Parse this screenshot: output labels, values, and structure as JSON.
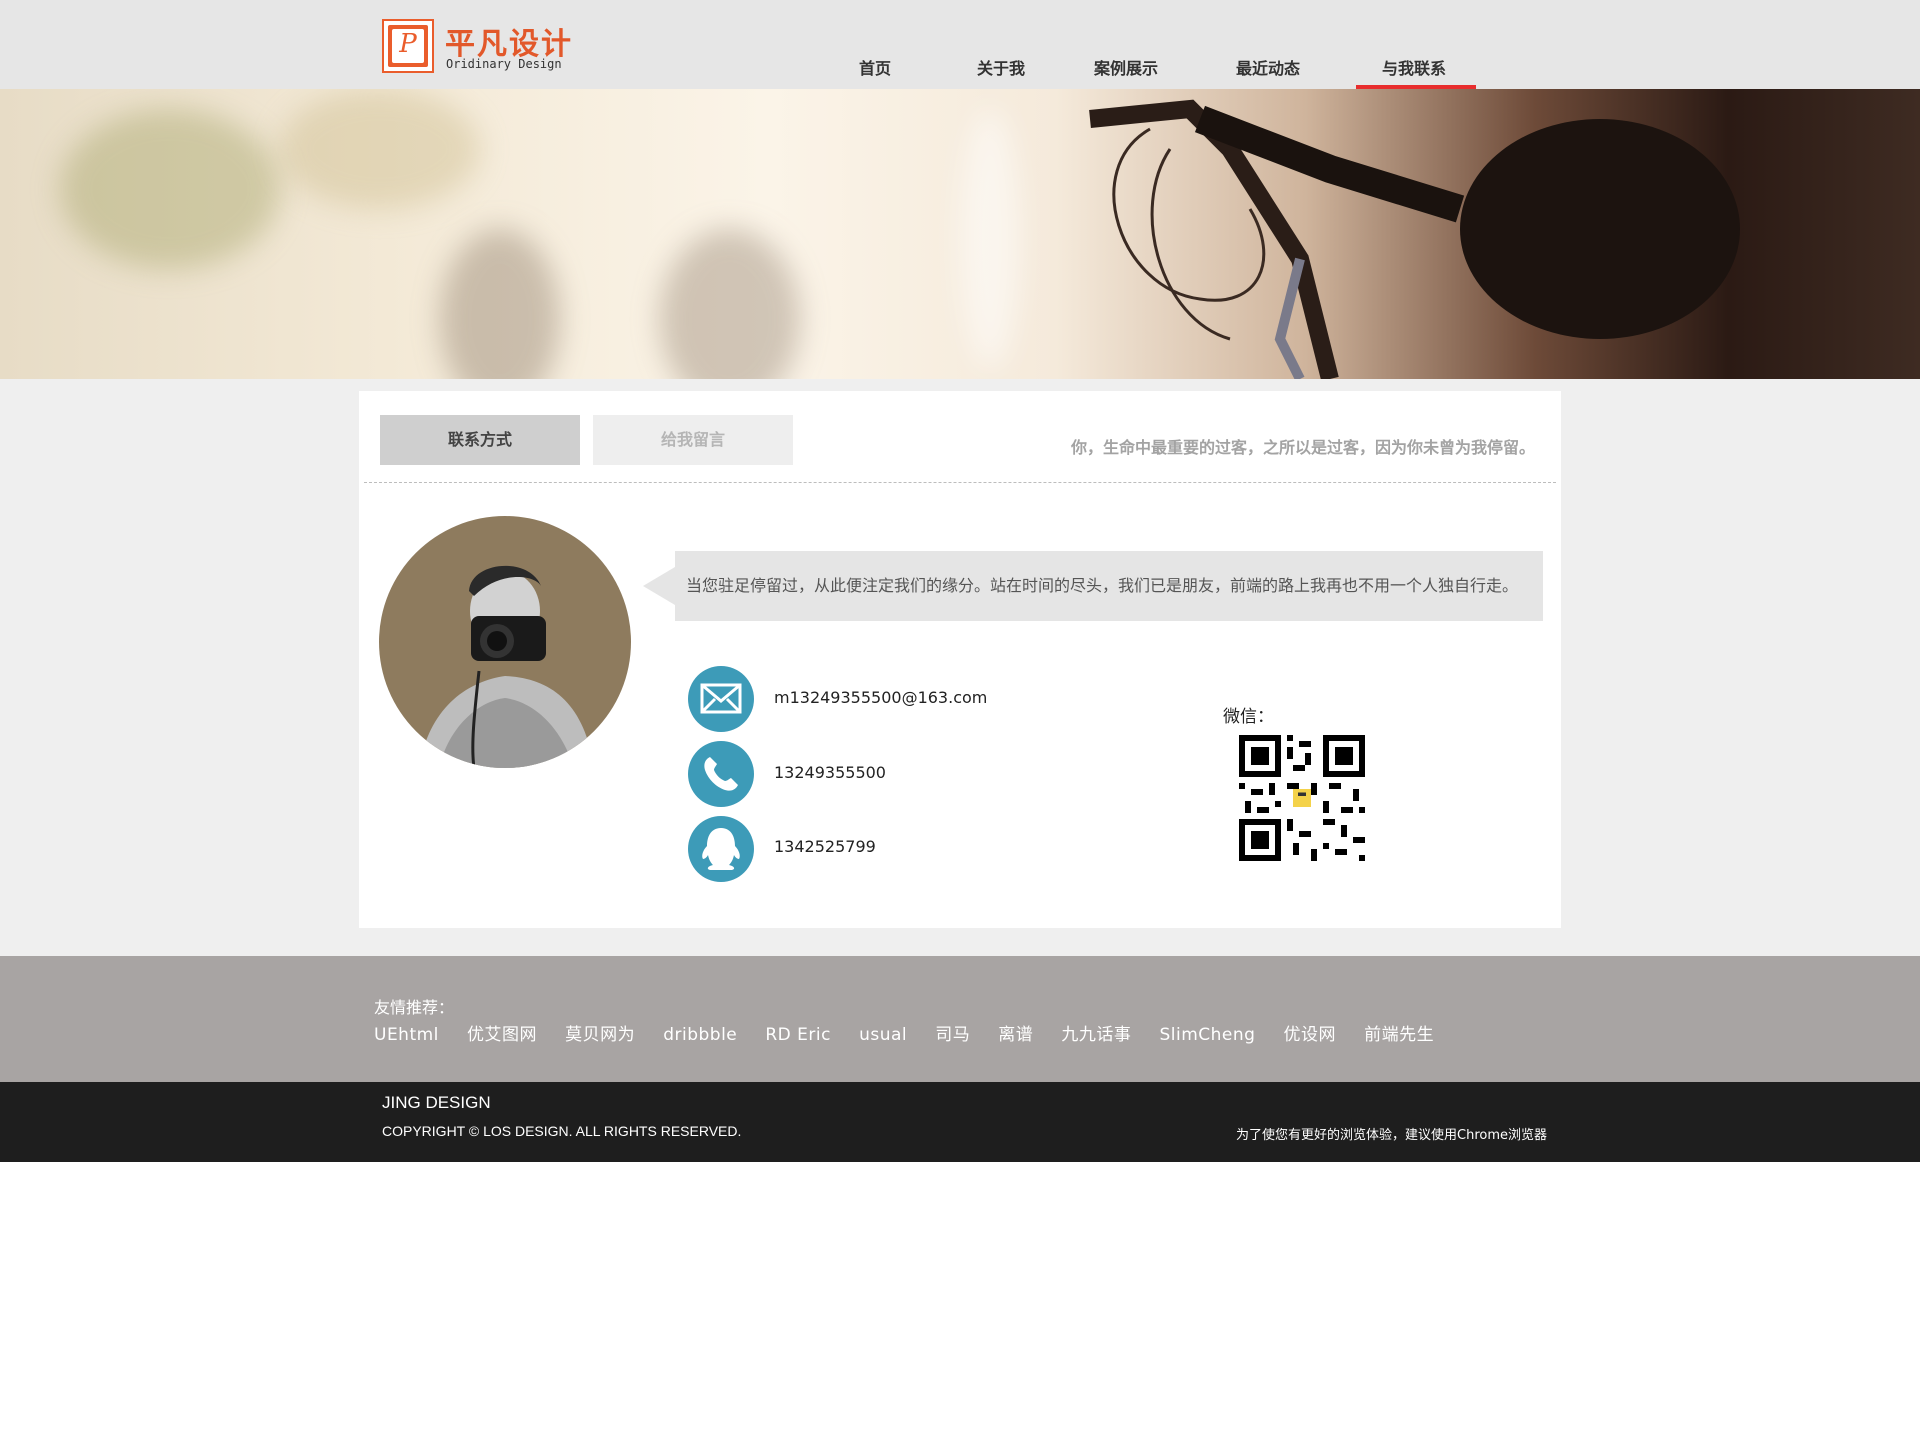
{
  "header": {
    "logo_mark": "P",
    "logo_cn": "平凡设计",
    "logo_en": "Oridinary Design",
    "nav": [
      "首页",
      "关于我",
      "案例展示",
      "最近动态",
      "与我联系"
    ],
    "active_nav": "与我联系",
    "accent_color": "#e82d2d"
  },
  "tabs": {
    "contact": "联系方式",
    "message": "给我留言"
  },
  "quote": "你，生命中最重要的过客，之所以是过客，因为你未曾为我停留。",
  "bubble": "当您驻足停留过，从此便注定我们的缘分。站在时间的尽头，我们已是朋友，前端的路上我再也不用一个人独自行走。",
  "contacts": {
    "email": "m13249355500@163.com",
    "phone": "13249355500",
    "qq": "1342525799",
    "wechat_label": "微信："
  },
  "friends": {
    "title": "友情推荐：",
    "links": [
      "UEhtml",
      "优艾图网",
      "莫贝网为",
      "dribbble",
      "RD Eric",
      "usual",
      "司马",
      "离谱",
      "九九话事",
      "SlimCheng",
      "优设网",
      "前端先生"
    ]
  },
  "footer": {
    "brand": "JING DESIGN",
    "copyright": "COPYRIGHT © LOS DESIGN. ALL RIGHTS RESERVED.",
    "tip": "为了使您有更好的浏览体验，建议使用Chrome浏览器"
  },
  "icons": [
    "mail-icon",
    "phone-icon",
    "qq-icon",
    "qr-code",
    "avatar"
  ]
}
